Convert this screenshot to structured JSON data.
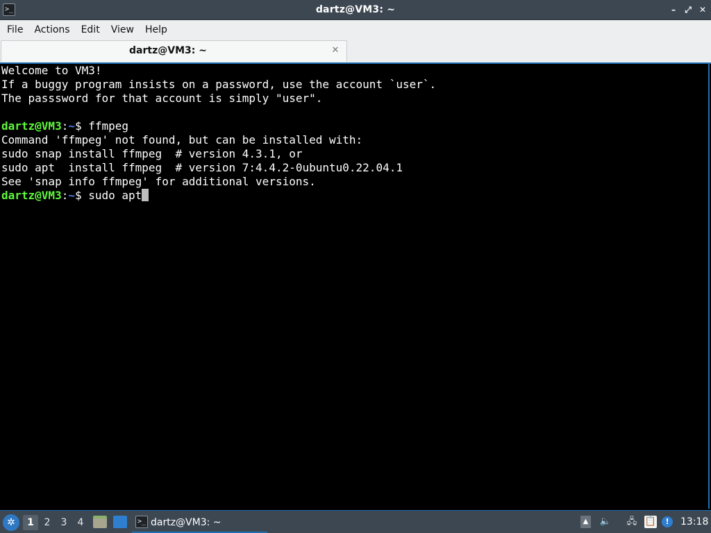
{
  "window": {
    "title": "dartz@VM3: ~",
    "app_icon_glyph": ">_",
    "controls": {
      "minimize": "–",
      "maximize": "⤢",
      "close": "✕"
    }
  },
  "menu": {
    "items": [
      {
        "label": "File"
      },
      {
        "label": "Actions"
      },
      {
        "label": "Edit"
      },
      {
        "label": "View"
      },
      {
        "label": "Help"
      }
    ]
  },
  "tab": {
    "label": "dartz@VM3: ~",
    "close_glyph": "✕"
  },
  "terminal": {
    "prompt": {
      "user_host": "dartz@VM3",
      "sep": ":",
      "dir": "~",
      "symbol": "$ "
    },
    "welcome": [
      "Welcome to VM3!",
      "If a buggy program insists on a password, use the account `user`.",
      "The passsword for that account is simply \"user\"."
    ],
    "cmd1": "ffmpeg",
    "output": [
      "Command 'ffmpeg' not found, but can be installed with:",
      "sudo snap install ffmpeg  # version 4.3.1, or",
      "sudo apt  install ffmpeg  # version 7:4.4.2-0ubuntu0.22.04.1",
      "See 'snap info ffmpeg' for additional versions."
    ],
    "current_input": "sudo apt"
  },
  "taskbar": {
    "start_glyph": "✲",
    "workspaces": [
      "1",
      "2",
      "3",
      "4"
    ],
    "active_workspace": "1",
    "task": {
      "label": "dartz@VM3: ~",
      "icon_glyph": ">_"
    },
    "tray": {
      "upload_glyph": "▲",
      "volume_glyph": "🔈",
      "network_glyph": "🖧",
      "clipboard_glyph": "📋",
      "update_glyph": "!"
    },
    "clock": "13:18"
  },
  "colors": {
    "accent": "#1f6fb5",
    "prompt_user": "#5ff93c",
    "prompt_dir": "#4a7fe8",
    "terminal_bg": "#000000",
    "panel_bg": "#3d4752"
  }
}
